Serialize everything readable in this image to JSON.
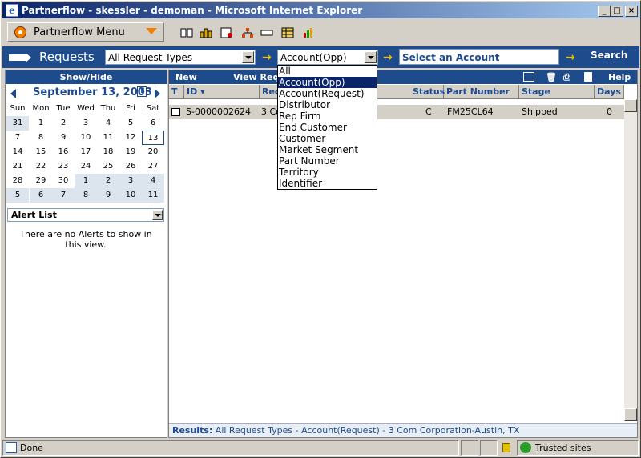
{
  "window": {
    "title": "Partnerflow - skessler - demoman - Microsoft Internet Explorer"
  },
  "toolbar": {
    "menu_label": "Partnerflow Menu"
  },
  "request_bar": {
    "label": "Requests",
    "request_type": "All Request Types",
    "filter_value": "Account(Opp)",
    "account_placeholder": "Select an Account",
    "search_label": "Search"
  },
  "dropdown": {
    "options": [
      "All",
      "Account(Opp)",
      "Account(Request)",
      "Distributor",
      "Rep Firm",
      "End Customer",
      "Customer",
      "Market Segment",
      "Part Number",
      "Territory",
      "Identifier"
    ],
    "selected_index": 1
  },
  "left": {
    "showhide_label": "Show/Hide",
    "calendar": {
      "month_label": "September 13, 2003",
      "today_button": "T",
      "weekdays": [
        "Sun",
        "Mon",
        "Tue",
        "Wed",
        "Thu",
        "Fri",
        "Sat"
      ],
      "weeks": [
        [
          "31",
          "1",
          "2",
          "3",
          "4",
          "5",
          "6"
        ],
        [
          "7",
          "8",
          "9",
          "10",
          "11",
          "12",
          "13"
        ],
        [
          "14",
          "15",
          "16",
          "17",
          "18",
          "19",
          "20"
        ],
        [
          "21",
          "22",
          "23",
          "24",
          "25",
          "26",
          "27"
        ],
        [
          "28",
          "29",
          "30",
          "1",
          "2",
          "3",
          "4"
        ],
        [
          "5",
          "6",
          "7",
          "8",
          "9",
          "10",
          "11"
        ]
      ]
    },
    "alert_select": "Alert List",
    "no_alerts": "There are no Alerts to show in this view."
  },
  "main": {
    "toolbar": {
      "new_label": "New",
      "view_label": "View Requ",
      "help_label": "Help"
    },
    "columns": {
      "t": "T",
      "id": "ID",
      "req": "Rec",
      "status": "Status",
      "part": "Part Number",
      "stage": "Stage",
      "days": "Days"
    },
    "rows": [
      {
        "id": "S-0000002624",
        "req": "3 Co",
        "status": "C",
        "part": "FM25CL64",
        "stage": "Shipped",
        "days": "0"
      }
    ],
    "results_label": "Results:",
    "results_text": "All Request Types - Account(Request) - 3 Com Corporation-Austin, TX"
  },
  "statusbar": {
    "status": "Done",
    "zone": "Trusted sites"
  }
}
